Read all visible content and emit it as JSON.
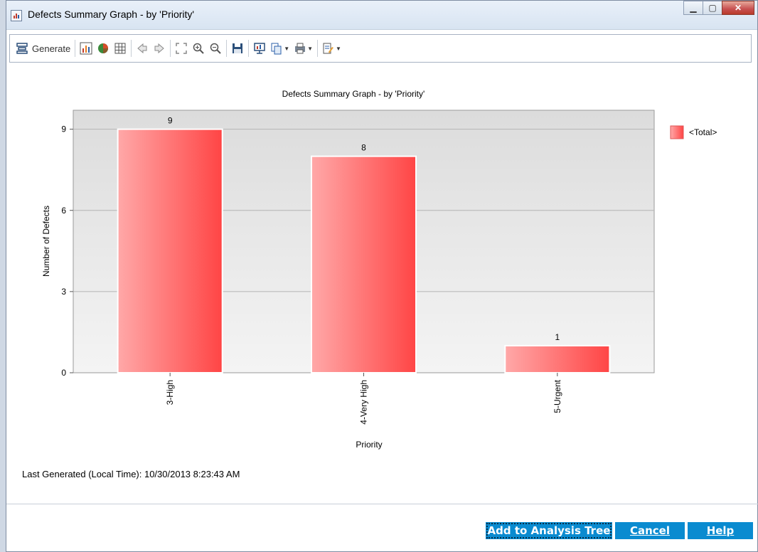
{
  "window": {
    "title": "Defects Summary Graph - by 'Priority'"
  },
  "toolbar": {
    "generate_label": "Generate",
    "icons": [
      "generate-icon",
      "bar-chart-icon",
      "pie-chart-icon",
      "grid-icon",
      "back-icon",
      "forward-icon",
      "fit-icon",
      "zoom-in-icon",
      "zoom-out-icon",
      "save-icon",
      "export-icon",
      "copy-icon",
      "print-icon",
      "settings-icon"
    ]
  },
  "chart_data": {
    "type": "bar",
    "title": "Defects Summary Graph - by 'Priority'",
    "xlabel": "Priority",
    "ylabel": "Number of Defects",
    "categories": [
      "3-High",
      "4-Very High",
      "5-Urgent"
    ],
    "series": [
      {
        "name": "<Total>",
        "values": [
          9,
          8,
          1
        ]
      }
    ],
    "ylim": [
      0,
      9.7
    ],
    "yticks": [
      0,
      3,
      6,
      9
    ],
    "grid": true,
    "legend": "right",
    "colors": {
      "bar_light": "#ffa8a8",
      "bar_dark": "#ff4545",
      "plot_bg_top": "#dcdcdc",
      "plot_bg_bottom": "#f4f4f4"
    }
  },
  "footer": {
    "last_generated": "Last Generated (Local Time): 10/30/2013 8:23:43 AM",
    "add_button": "Add to Analysis Tree",
    "cancel_button": "Cancel",
    "help_button": "Help"
  },
  "colors": {
    "button": "#0a8bd0"
  }
}
